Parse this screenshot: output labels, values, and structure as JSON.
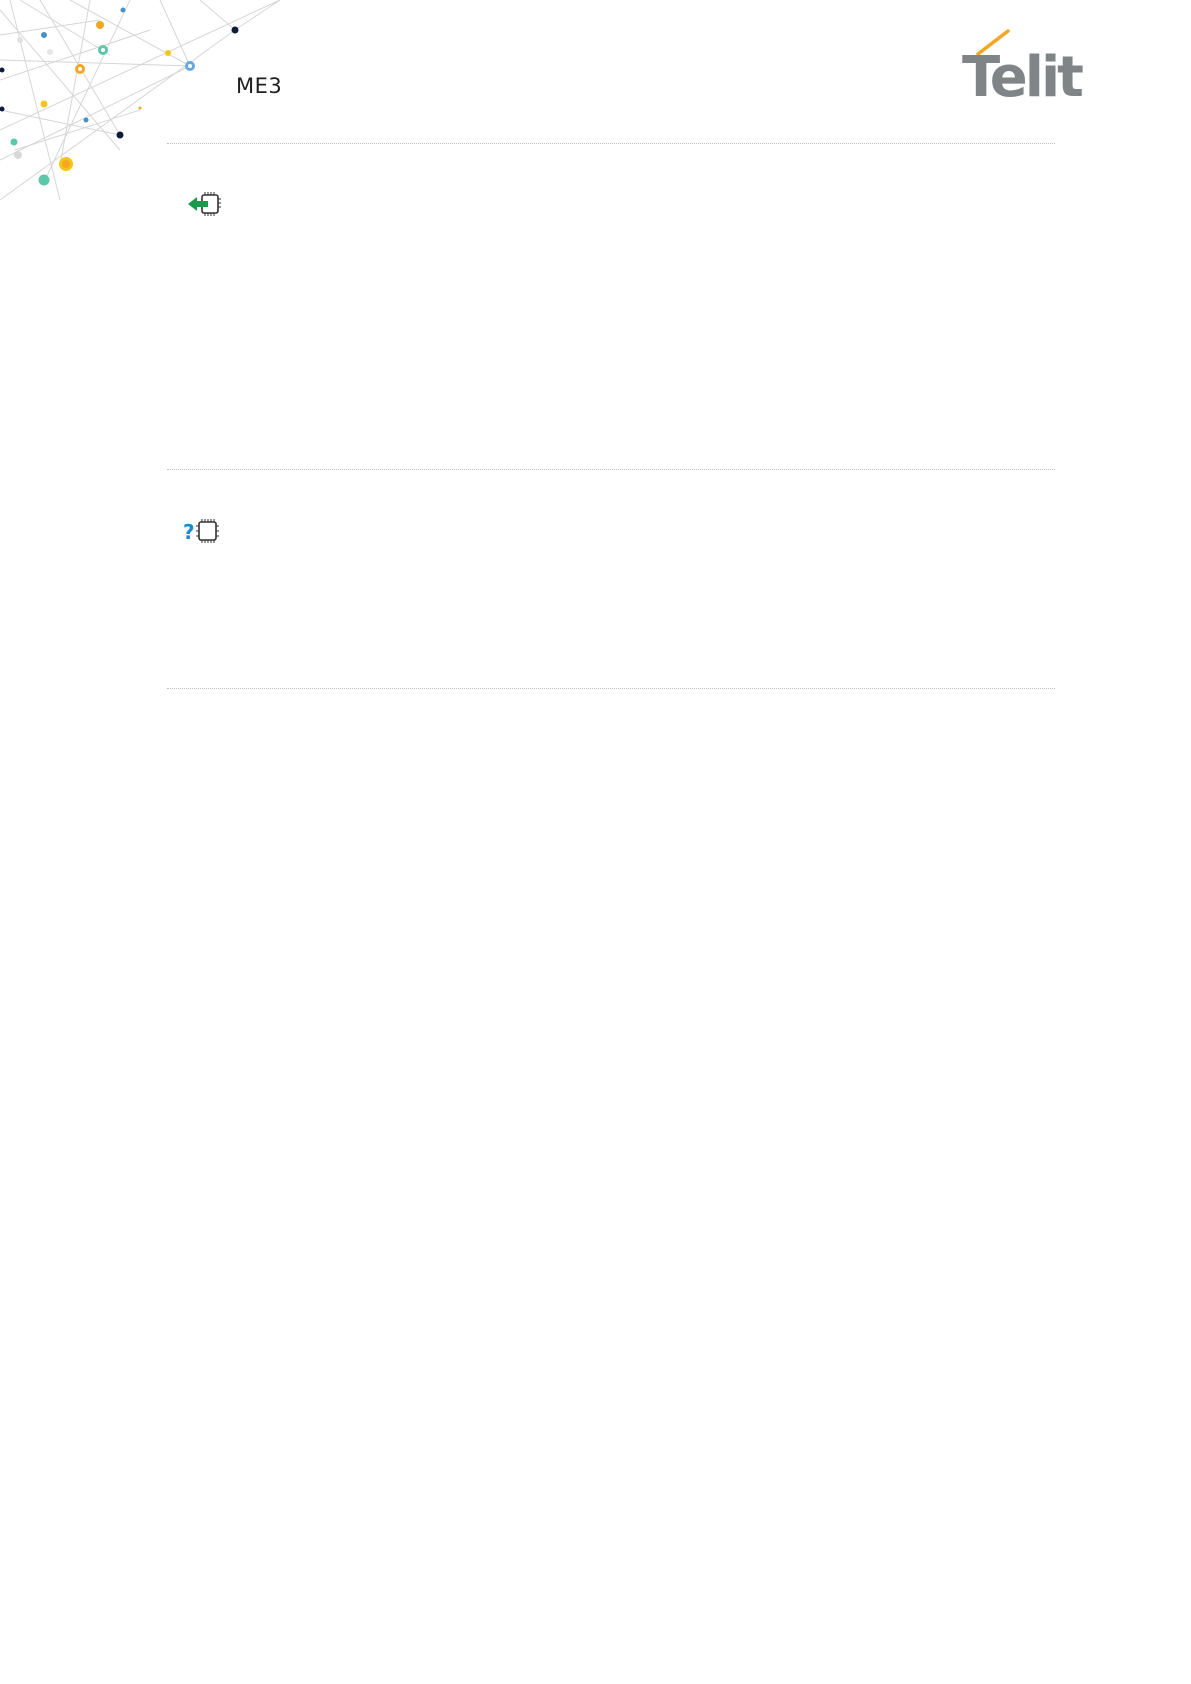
{
  "header": {
    "product_label": "ME3",
    "logo_text": "Telit",
    "brand_color": "#7f8586",
    "accent_color": "#f5a623"
  },
  "sections": [
    {
      "icon": "set-command-arrow-chip-icon",
      "icon_color": "#1a9a4a"
    },
    {
      "icon": "read-command-question-chip-icon",
      "icon_color": "#1e88c8"
    }
  ]
}
